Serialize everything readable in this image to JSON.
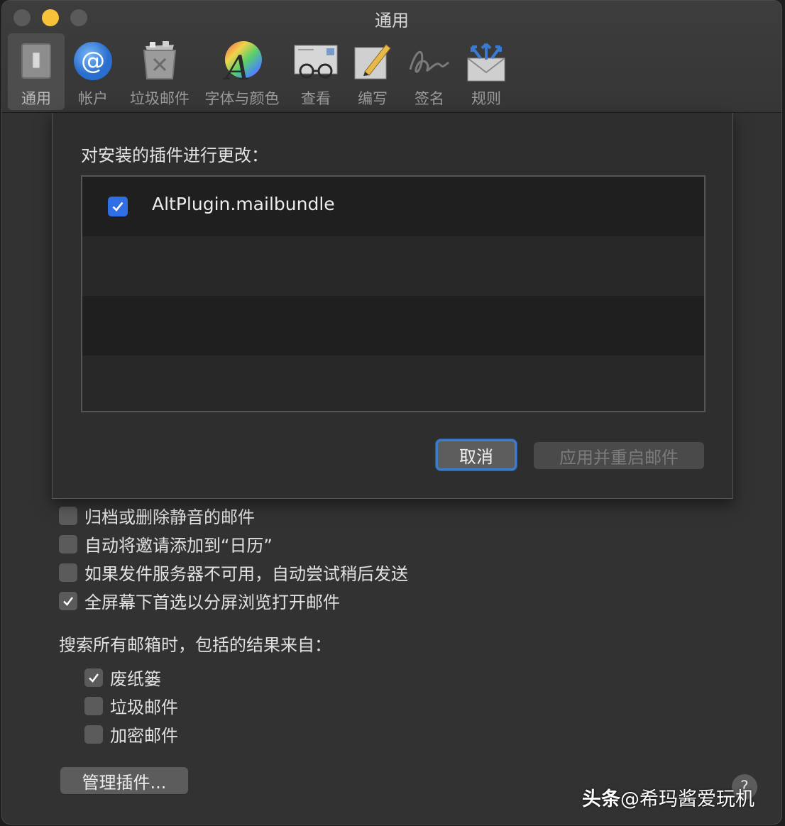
{
  "window": {
    "title": "通用"
  },
  "toolbar": {
    "items": [
      {
        "label": "通用",
        "icon": "general-switch-icon",
        "active": true
      },
      {
        "label": "帐户",
        "icon": "at-sign-icon"
      },
      {
        "label": "垃圾邮件",
        "icon": "junk-bin-icon"
      },
      {
        "label": "字体与颜色",
        "icon": "font-color-wheel-icon"
      },
      {
        "label": "查看",
        "icon": "glasses-envelope-icon"
      },
      {
        "label": "编写",
        "icon": "pencil-note-icon"
      },
      {
        "label": "签名",
        "icon": "signature-icon"
      },
      {
        "label": "规则",
        "icon": "rules-envelope-icon"
      }
    ]
  },
  "sheet": {
    "title": "对安装的插件进行更改：",
    "plugins": [
      {
        "name": "AltPlugin.mailbundle",
        "checked": true
      }
    ],
    "cancel_label": "取消",
    "apply_label": "应用并重启邮件"
  },
  "options": [
    {
      "label": "归档或删除静音的邮件",
      "checked": false
    },
    {
      "label": "自动将邀请添加到“日历”",
      "checked": false
    },
    {
      "label": "如果发件服务器不可用，自动尝试稍后发送",
      "checked": false
    },
    {
      "label": "全屏幕下首选以分屏浏览打开邮件",
      "checked": true
    }
  ],
  "search": {
    "label": "搜索所有邮箱时，包括的结果来自：",
    "items": [
      {
        "label": "废纸篓",
        "checked": true
      },
      {
        "label": "垃圾邮件",
        "checked": false
      },
      {
        "label": "加密邮件",
        "checked": false
      }
    ]
  },
  "manage_label": "管理插件...",
  "help_label": "?",
  "watermark": {
    "brand": "头条",
    "handle": "@希玛酱爱玩机"
  },
  "colors": {
    "accent": "#2f6ee5",
    "focus_ring": "#3d7cc9",
    "minimize": "#f5c23a"
  }
}
